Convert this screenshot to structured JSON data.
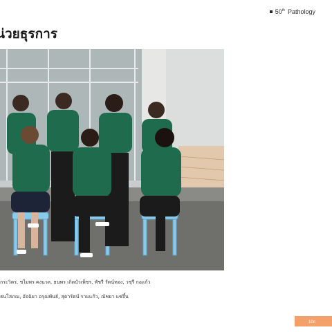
{
  "header": {
    "brand_number": "50",
    "brand_superscript": "th",
    "brand_name": "Pathology"
  },
  "page": {
    "title": "น่วยธุรการ",
    "caption_line1": "กระวิตร, ชไมพร คงนวล, ธนพร เกิดบัวเพ็ชร, พัชรี รัตน์ทอง, วชุรี กอแก้ว",
    "caption_line2": "ธนโสภณ, อัจฉิยา อรุณพันธ์, สุดารัตน์ รามแก้ว, ณัชยา แซ่จึ้น",
    "page_number": "10ธ"
  },
  "photo": {
    "description_icon": "group-photo-icon"
  },
  "colors": {
    "accent": "#f4a06b",
    "uniform": "#1f6b4e",
    "chair": "#7fc3e6"
  }
}
